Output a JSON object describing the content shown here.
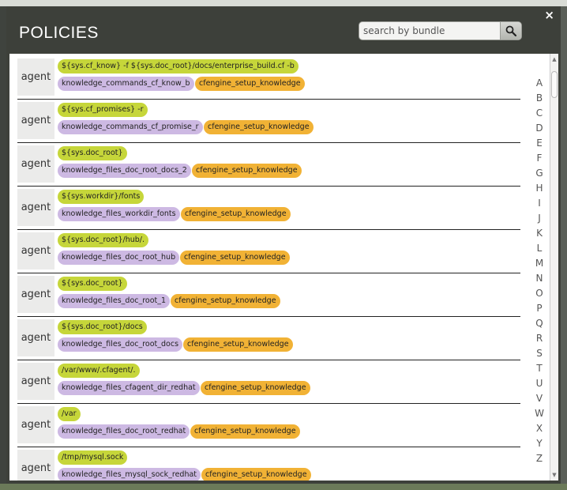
{
  "dialog": {
    "title": "POLICIES",
    "close_label": "×",
    "search": {
      "placeholder": "search by bundle",
      "value": ""
    }
  },
  "policies": [
    {
      "type": "agent",
      "promiser": "${sys.cf_know} -f ${sys.doc_root}/docs/enterprise_build.cf -b",
      "promise": "knowledge_commands_cf_know_b",
      "bundle": "cfengine_setup_knowledge"
    },
    {
      "type": "agent",
      "promiser": "${sys.cf_promises} -r",
      "promise": "knowledge_commands_cf_promise_r",
      "bundle": "cfengine_setup_knowledge"
    },
    {
      "type": "agent",
      "promiser": "${sys.doc_root}",
      "promise": "knowledge_files_doc_root_docs_2",
      "bundle": "cfengine_setup_knowledge"
    },
    {
      "type": "agent",
      "promiser": "${sys.workdir}/fonts",
      "promise": "knowledge_files_workdir_fonts",
      "bundle": "cfengine_setup_knowledge"
    },
    {
      "type": "agent",
      "promiser": "${sys.doc_root}/hub/.",
      "promise": "knowledge_files_doc_root_hub",
      "bundle": "cfengine_setup_knowledge"
    },
    {
      "type": "agent",
      "promiser": "${sys.doc_root}",
      "promise": "knowledge_files_doc_root_1",
      "bundle": "cfengine_setup_knowledge"
    },
    {
      "type": "agent",
      "promiser": "${sys.doc_root}/docs",
      "promise": "knowledge_files_doc_root_docs",
      "bundle": "cfengine_setup_knowledge"
    },
    {
      "type": "agent",
      "promiser": "/var/www/.cfagent/.",
      "promise": "knowledge_files_cfagent_dir_redhat",
      "bundle": "cfengine_setup_knowledge"
    },
    {
      "type": "agent",
      "promiser": "/var",
      "promise": "knowledge_files_doc_root_redhat",
      "bundle": "cfengine_setup_knowledge"
    },
    {
      "type": "agent",
      "promiser": "/tmp/mysql.sock",
      "promise": "knowledge_files_mysql_sock_redhat",
      "bundle": "cfengine_setup_knowledge"
    }
  ],
  "alphabet": [
    "A",
    "B",
    "C",
    "D",
    "E",
    "F",
    "G",
    "H",
    "I",
    "J",
    "K",
    "L",
    "M",
    "N",
    "O",
    "P",
    "Q",
    "R",
    "S",
    "T",
    "U",
    "V",
    "W",
    "X",
    "Y",
    "Z"
  ],
  "colors": {
    "header_bg": "#3d403a",
    "promiser_pill": "#c6d63a",
    "promise_pill": "#cdb9e3",
    "bundle_pill": "#f1b235"
  },
  "icons": {
    "search": "magnifier-icon",
    "close": "close-icon"
  }
}
